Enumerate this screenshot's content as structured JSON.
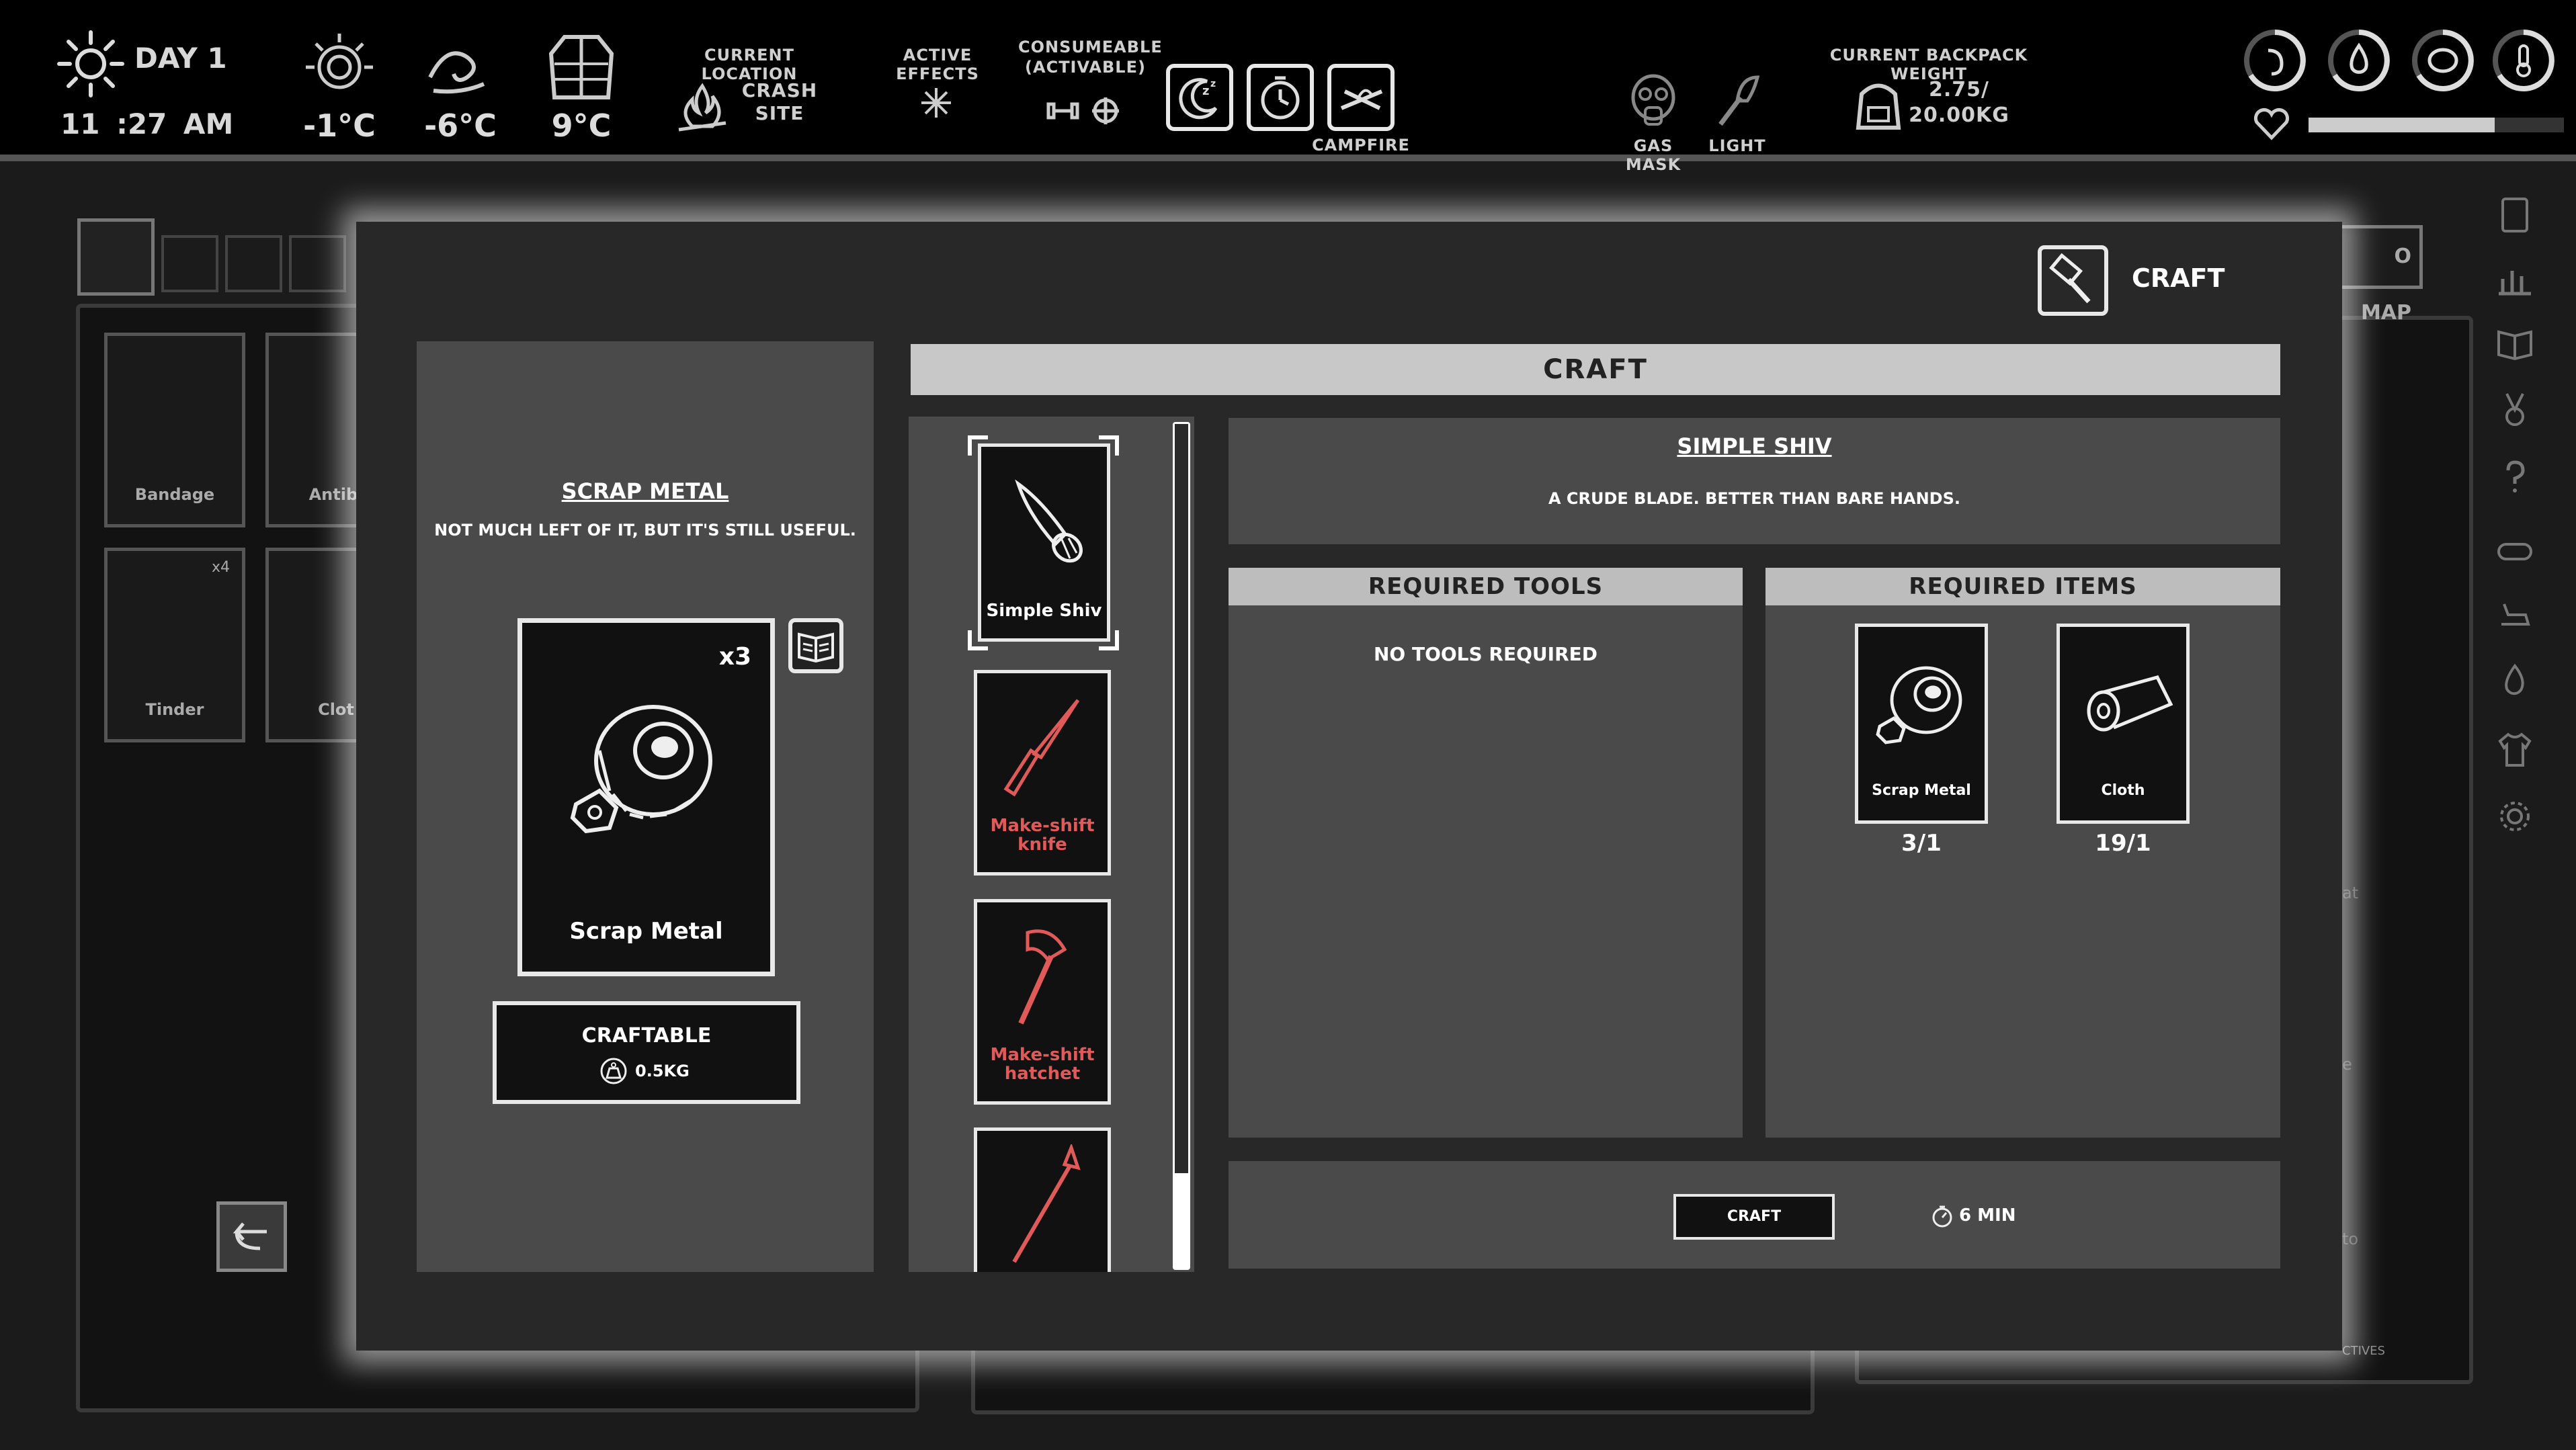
{
  "hud": {
    "day": "DAY 1",
    "time": "11 :27 AM",
    "temps": [
      "-1°C",
      "-6°C",
      "9°C"
    ],
    "current_location_label": "CURRENT LOCATION",
    "current_location_value": "CRASH SITE",
    "active_effects_label": "ACTIVE EFFECTS",
    "consumable_label": "CONSUMEABLE (ACTIVABLE)",
    "campfire_label": "CAMPFIRE",
    "gas_mask_label": "GAS MASK",
    "light_label": "LIGHT",
    "backpack_label": "CURRENT BACKPACK WEIGHT",
    "backpack_weight": "2.75/ 20.00KG",
    "health_fill": 0.73
  },
  "background": {
    "inventory_items": [
      {
        "label": "Bandage",
        "count": ""
      },
      {
        "label": "Antibi",
        "count": ""
      },
      {
        "label": "Tinder",
        "count": "x4"
      },
      {
        "label": "Clot",
        "count": ""
      }
    ],
    "map_button": "O MAP",
    "objectives_button": "CTIVES",
    "faint_texts": [
      "at",
      "e",
      "to"
    ]
  },
  "modal": {
    "title": "CRAFT",
    "header": "CRAFT",
    "selected_item": {
      "name": "SCRAP METAL",
      "description": "NOT MUCH LEFT OF IT, BUT IT'S STILL USEFUL.",
      "card_label": "Scrap Metal",
      "count": "x3",
      "status": "CRAFTABLE",
      "weight": "0.5KG"
    },
    "recipes": [
      {
        "label": "Simple Shiv",
        "available": true
      },
      {
        "label": "Make-shift knife",
        "available": false
      },
      {
        "label": "Make-shift hatchet",
        "available": false
      },
      {
        "label": "",
        "available": false
      }
    ],
    "recipe": {
      "name": "SIMPLE SHIV",
      "description": "A CRUDE BLADE. BETTER THAN BARE HANDS.",
      "required_tools_label": "REQUIRED TOOLS",
      "no_tools": "NO TOOLS REQUIRED",
      "required_items_label": "REQUIRED ITEMS",
      "items": [
        {
          "label": "Scrap Metal",
          "qty": "3/1"
        },
        {
          "label": "Cloth",
          "qty": "19/1"
        }
      ],
      "craft_button": "CRAFT",
      "time": "6 MIN"
    }
  },
  "colors": {
    "modal_bg": "#282828",
    "panel_bg": "#4a4a4a",
    "header_bg": "#c8c8c8",
    "unavailable_red": "#e05a5a"
  }
}
